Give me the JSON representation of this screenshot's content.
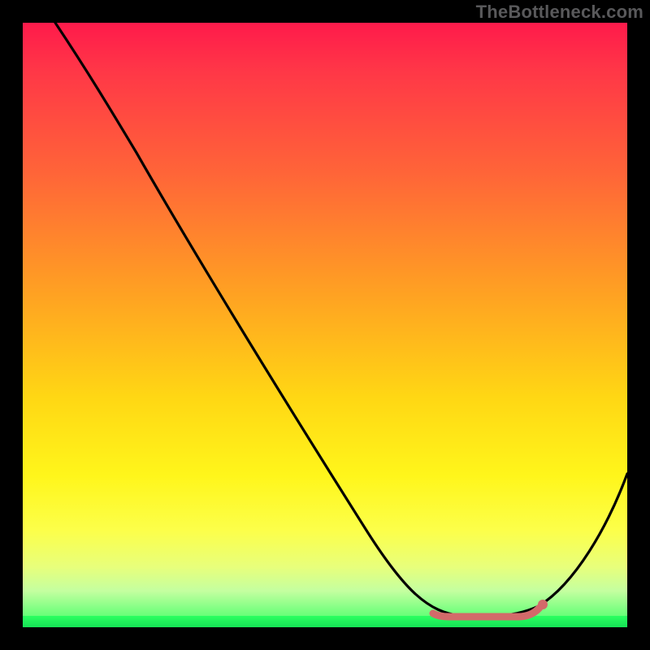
{
  "watermark": "TheBottleneck.com",
  "colors": {
    "frame": "#000000",
    "curve": "#000000",
    "marker": "#d36a6a",
    "gradient_top": "#ff1a4b",
    "gradient_bottom": "#15e356"
  },
  "chart_data": {
    "type": "line",
    "title": "",
    "xlabel": "",
    "ylabel": "",
    "xlim": [
      0,
      100
    ],
    "ylim": [
      0,
      100
    ],
    "x": [
      0,
      6,
      12,
      18,
      24,
      30,
      36,
      42,
      48,
      54,
      60,
      64,
      68,
      72,
      76,
      80,
      84,
      88,
      92,
      96,
      100
    ],
    "series": [
      {
        "name": "bottleneck-curve",
        "values": [
          100,
          95,
          88,
          80,
          72,
          64,
          56,
          48,
          40,
          32,
          24,
          17,
          11,
          5,
          2,
          1,
          1,
          3,
          9,
          18,
          30
        ]
      }
    ],
    "flat_region": {
      "x_start": 70,
      "x_end": 86,
      "y_approx": 1
    },
    "marker_point": {
      "x": 86,
      "y": 3
    }
  }
}
